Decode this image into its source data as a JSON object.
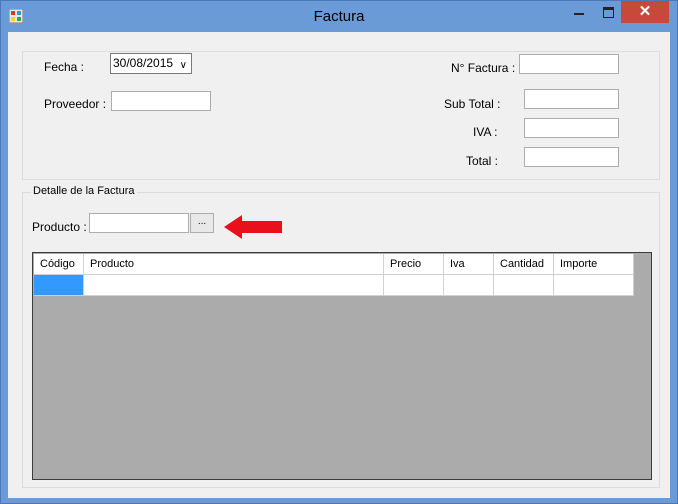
{
  "window": {
    "title": "Factura"
  },
  "header": {
    "fecha_label": "Fecha :",
    "fecha_value": "30/08/2015",
    "proveedor_label": "Proveedor :",
    "nfactura_label": "N° Factura :",
    "subtotal_label": "Sub Total :",
    "iva_label": "IVA :",
    "total_label": "Total :"
  },
  "detail": {
    "legend": "Detalle de la Factura",
    "producto_label": "Producto :",
    "browse_label": "...",
    "columns": [
      "Código",
      "Producto",
      "Precio",
      "Iva",
      "Cantidad",
      "Importe"
    ]
  },
  "colors": {
    "titlebar": "#6b9bd6",
    "close": "#c7493a",
    "arrow": "#e8101a",
    "selected_cell": "#3399ff",
    "grid_bg": "#ababab"
  }
}
